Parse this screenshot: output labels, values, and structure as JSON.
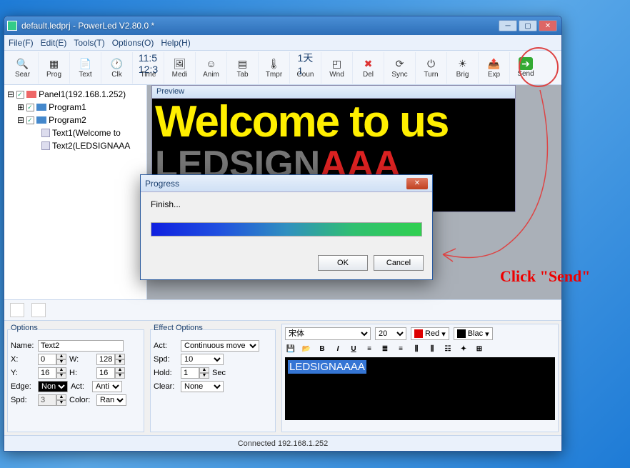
{
  "titlebar": {
    "title": "default.ledprj - PowerLed V2.80.0 *"
  },
  "menu": {
    "file": "File(F)",
    "edit": "Edit(E)",
    "tools": "Tools(T)",
    "options": "Options(O)",
    "help": "Help(H)"
  },
  "toolbar": {
    "sear": "Sear",
    "prog": "Prog",
    "text": "Text",
    "clk": "Clk",
    "time": "Time",
    "medi": "Medi",
    "anim": "Anim",
    "tab": "Tab",
    "tmpr": "Tmpr",
    "coun": "Coun",
    "wnd": "Wnd",
    "del": "Del",
    "sync": "Sync",
    "turn": "Turn",
    "brig": "Brig",
    "exp": "Exp",
    "send": "Send"
  },
  "tree": {
    "panel": "Panel1(192.168.1.252)",
    "prog1": "Program1",
    "prog2": "Program2",
    "text1": "Text1(Welcome to",
    "text2": "Text2(LEDSIGNAAA"
  },
  "preview": {
    "title": "Preview",
    "line1": "Welcome to us",
    "line2a": "LEDSIGN",
    "line2b": "AAA"
  },
  "options": {
    "legend": "Options",
    "name_l": "Name:",
    "name_v": "Text2",
    "x_l": "X:",
    "x_v": "0",
    "w_l": "W:",
    "w_v": "128",
    "y_l": "Y:",
    "y_v": "16",
    "h_l": "H:",
    "h_v": "16",
    "edge_l": "Edge:",
    "edge_v": "Non",
    "act_l": "Act:",
    "act_v": "Anti",
    "spd_l": "Spd:",
    "spd_v": "3",
    "color_l": "Color:",
    "color_v": "Ranc"
  },
  "effect": {
    "legend": "Effect Options",
    "act_l": "Act:",
    "act_v": "Continuous move",
    "spd_l": "Spd:",
    "spd_v": "10",
    "hold_l": "Hold:",
    "hold_v": "1",
    "hold_u": "Sec",
    "clear_l": "Clear:",
    "clear_v": "None"
  },
  "text": {
    "font": "宋体",
    "size": "20",
    "fg": "Red",
    "bg": "Blac",
    "content": "LEDSIGNAAAA"
  },
  "dialog": {
    "title": "Progress",
    "msg": "Finish...",
    "ok": "OK",
    "cancel": "Cancel"
  },
  "status": {
    "conn": "Connected 192.168.1.252"
  },
  "annot": {
    "send": "Click  \"Send\""
  }
}
